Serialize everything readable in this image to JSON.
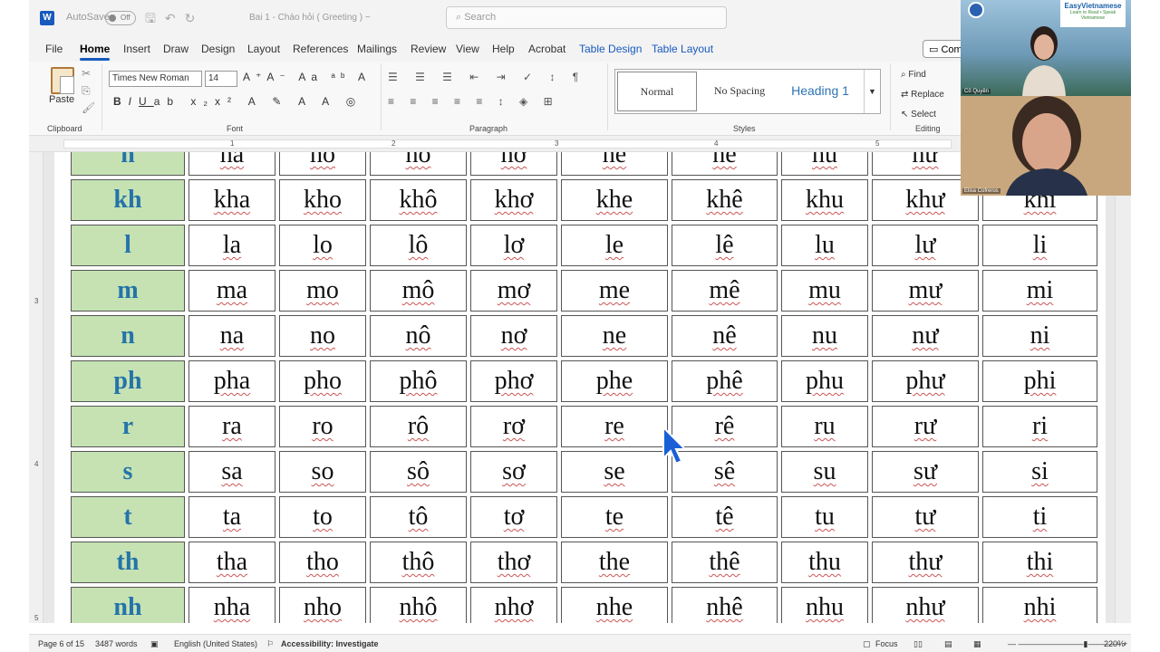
{
  "titlebar": {
    "autosave_label": "AutoSave",
    "toggle_label": "Off",
    "document_title": "Bai 1 - Chào hỏi ( Greeting ) ~",
    "search_placeholder": "Search"
  },
  "menu": {
    "tabs": [
      "File",
      "Home",
      "Insert",
      "Draw",
      "Design",
      "Layout",
      "References",
      "Mailings",
      "Review",
      "View",
      "Help",
      "Acrobat",
      "Table Design",
      "Table Layout"
    ],
    "comments_label": "Com"
  },
  "ribbon": {
    "paste_label": "Paste",
    "clipboard_label": "Clipboard",
    "font_name": "Times New Roman",
    "font_size": "14",
    "font_label": "Font",
    "paragraph_label": "Paragraph",
    "styles_label": "Styles",
    "styles": [
      "Normal",
      "No Spacing",
      "Heading 1"
    ],
    "editing_label": "Editing",
    "editing_items": [
      "Find",
      "Replace",
      "Select"
    ]
  },
  "table": {
    "rows": [
      {
        "head": "h",
        "cells": [
          "ha",
          "ho",
          "hô",
          "hơ",
          "he",
          "hê",
          "hu",
          "hư",
          "hi"
        ]
      },
      {
        "head": "kh",
        "cells": [
          "kha",
          "kho",
          "khô",
          "khơ",
          "khe",
          "khê",
          "khu",
          "khư",
          "khi"
        ]
      },
      {
        "head": "l",
        "cells": [
          "la",
          "lo",
          "lô",
          "lơ",
          "le",
          "lê",
          "lu",
          "lư",
          "li"
        ]
      },
      {
        "head": "m",
        "cells": [
          "ma",
          "mo",
          "mô",
          "mơ",
          "me",
          "mê",
          "mu",
          "mư",
          "mi"
        ]
      },
      {
        "head": "n",
        "cells": [
          "na",
          "no",
          "nô",
          "nơ",
          "ne",
          "nê",
          "nu",
          "nư",
          "ni"
        ]
      },
      {
        "head": "ph",
        "cells": [
          "pha",
          "pho",
          "phô",
          "phơ",
          "phe",
          "phê",
          "phu",
          "phư",
          "phi"
        ]
      },
      {
        "head": "r",
        "cells": [
          "ra",
          "ro",
          "rô",
          "rơ",
          "re",
          "rê",
          "ru",
          "rư",
          "ri"
        ]
      },
      {
        "head": "s",
        "cells": [
          "sa",
          "so",
          "sô",
          "sơ",
          "se",
          "sê",
          "su",
          "sư",
          "si"
        ]
      },
      {
        "head": "t",
        "cells": [
          "ta",
          "to",
          "tô",
          "tơ",
          "te",
          "tê",
          "tu",
          "tư",
          "ti"
        ]
      },
      {
        "head": "th",
        "cells": [
          "tha",
          "tho",
          "thô",
          "thơ",
          "the",
          "thê",
          "thu",
          "thư",
          "thi"
        ]
      },
      {
        "head": "nh",
        "cells": [
          "nha",
          "nho",
          "nhô",
          "nhơ",
          "nhe",
          "nhê",
          "nhu",
          "như",
          "nhi"
        ]
      }
    ]
  },
  "status": {
    "page": "Page 6 of 15",
    "words": "3487 words",
    "language": "English (United States)",
    "accessibility": "Accessibility: Investigate",
    "focus": "Focus",
    "zoom": "220%"
  },
  "video": {
    "brand": "EasyVietnamese",
    "brand_sub": "Learn to Read • Speak Vietnamese",
    "participant1": "Cô Quyên",
    "participant2": "Elisa Cofreros"
  },
  "colors": {
    "head_fill": "#c6e2b3",
    "head_text": "#2474a9",
    "accent": "#185abd"
  }
}
